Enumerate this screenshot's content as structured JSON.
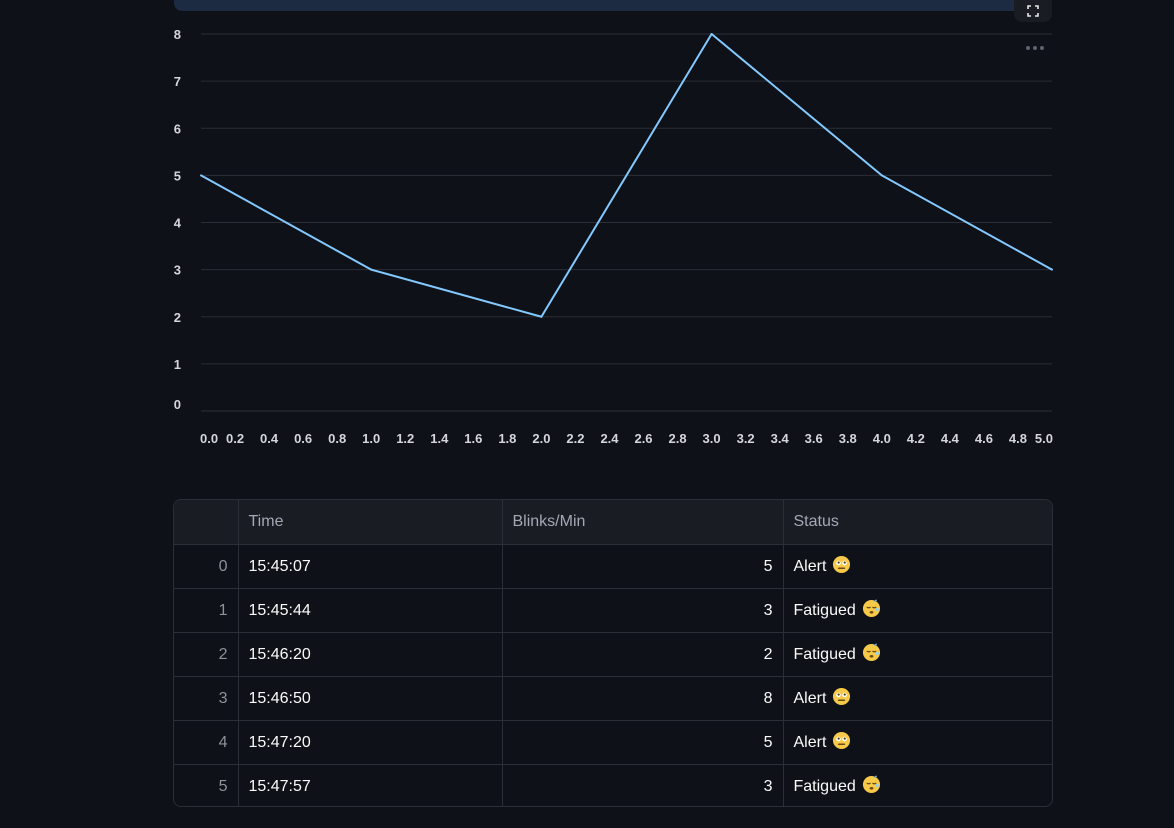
{
  "colors": {
    "background": "#0e1117",
    "line": "#83c9ff",
    "grid": "#2b2e37",
    "header_bg": "#1a1c24"
  },
  "toolbar": {
    "fullscreen_icon": "fullscreen-icon",
    "more_icon": "more-horizontal-icon"
  },
  "chart_data": {
    "type": "line",
    "x": [
      0,
      1,
      2,
      3,
      4,
      5
    ],
    "series": [
      {
        "values": [
          5,
          3,
          2,
          8,
          5,
          3
        ]
      }
    ],
    "xlim": [
      0,
      5
    ],
    "ylim": [
      0,
      8
    ],
    "x_ticks": [
      "0.0",
      "0.2",
      "0.4",
      "0.6",
      "0.8",
      "1.0",
      "1.2",
      "1.4",
      "1.6",
      "1.8",
      "2.0",
      "2.2",
      "2.4",
      "2.6",
      "2.8",
      "3.0",
      "3.2",
      "3.4",
      "3.6",
      "3.8",
      "4.0",
      "4.2",
      "4.4",
      "4.6",
      "4.8",
      "5.0"
    ],
    "y_ticks": [
      "0",
      "1",
      "2",
      "3",
      "4",
      "5",
      "6",
      "7",
      "8"
    ],
    "grid": true
  },
  "table": {
    "columns": [
      "",
      "Time",
      "Blinks/Min",
      "Status"
    ],
    "rows": [
      {
        "index": "0",
        "time": "15:45:07",
        "blinks": "5",
        "status": "Alert",
        "icon": "alert-face-icon"
      },
      {
        "index": "1",
        "time": "15:45:44",
        "blinks": "3",
        "status": "Fatigued",
        "icon": "sleepy-face-icon"
      },
      {
        "index": "2",
        "time": "15:46:20",
        "blinks": "2",
        "status": "Fatigued",
        "icon": "sleepy-face-icon"
      },
      {
        "index": "3",
        "time": "15:46:50",
        "blinks": "8",
        "status": "Alert",
        "icon": "alert-face-icon"
      },
      {
        "index": "4",
        "time": "15:47:20",
        "blinks": "5",
        "status": "Alert",
        "icon": "alert-face-icon"
      },
      {
        "index": "5",
        "time": "15:47:57",
        "blinks": "3",
        "status": "Fatigued",
        "icon": "sleepy-face-icon"
      }
    ]
  }
}
